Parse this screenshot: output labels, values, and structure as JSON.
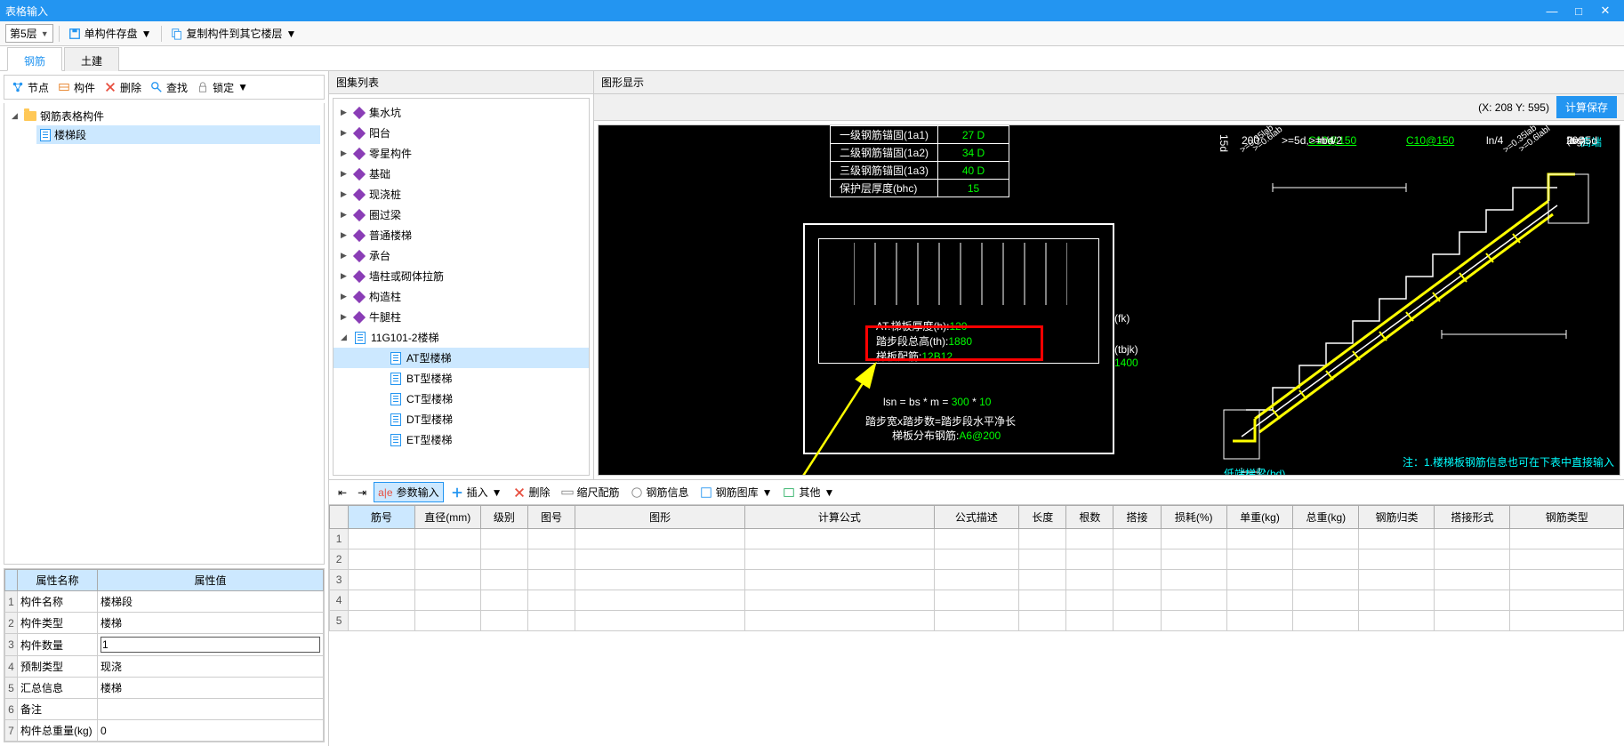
{
  "window": {
    "title": "表格输入"
  },
  "toolbar": {
    "floor_combo": "第5层",
    "save_single": "单构件存盘",
    "copy_to_floors": "复制构件到其它楼层"
  },
  "main_tabs": {
    "rebar": "钢筋",
    "civil": "土建"
  },
  "tree_toolbar": {
    "node": "节点",
    "component": "构件",
    "delete": "删除",
    "find": "查找",
    "lock": "锁定"
  },
  "tree": {
    "root": "钢筋表格构件",
    "child": "楼梯段"
  },
  "properties": {
    "header_name": "属性名称",
    "header_value": "属性值",
    "rows": [
      {
        "n": "1",
        "name": "构件名称",
        "value": "楼梯段"
      },
      {
        "n": "2",
        "name": "构件类型",
        "value": "楼梯"
      },
      {
        "n": "3",
        "name": "构件数量",
        "value": "1",
        "editing": true
      },
      {
        "n": "4",
        "name": "预制类型",
        "value": "现浇"
      },
      {
        "n": "5",
        "name": "汇总信息",
        "value": "楼梯"
      },
      {
        "n": "6",
        "name": "备注",
        "value": ""
      },
      {
        "n": "7",
        "name": "构件总重量(kg)",
        "value": "0"
      }
    ]
  },
  "catalog": {
    "header": "图集列表",
    "items": [
      {
        "label": "集水坑",
        "exp": "▶",
        "icon": "diamond"
      },
      {
        "label": "阳台",
        "exp": "▶",
        "icon": "diamond"
      },
      {
        "label": "零星构件",
        "exp": "▶",
        "icon": "diamond"
      },
      {
        "label": "基础",
        "exp": "▶",
        "icon": "diamond"
      },
      {
        "label": "现浇桩",
        "exp": "▶",
        "icon": "diamond"
      },
      {
        "label": "圈过梁",
        "exp": "▶",
        "icon": "diamond"
      },
      {
        "label": "普通楼梯",
        "exp": "▶",
        "icon": "diamond"
      },
      {
        "label": "承台",
        "exp": "▶",
        "icon": "diamond"
      },
      {
        "label": "墙柱或砌体拉筋",
        "exp": "▶",
        "icon": "diamond"
      },
      {
        "label": "构造柱",
        "exp": "▶",
        "icon": "diamond"
      },
      {
        "label": "牛腿柱",
        "exp": "▶",
        "icon": "diamond"
      },
      {
        "label": "11G101-2楼梯",
        "exp": "◢",
        "icon": "doc",
        "indent": 0
      },
      {
        "label": "AT型楼梯",
        "icon": "doc",
        "indent": 2,
        "selected": true
      },
      {
        "label": "BT型楼梯",
        "icon": "doc",
        "indent": 2
      },
      {
        "label": "CT型楼梯",
        "icon": "doc",
        "indent": 2
      },
      {
        "label": "DT型楼梯",
        "icon": "doc",
        "indent": 2
      },
      {
        "label": "ET型楼梯",
        "icon": "doc",
        "indent": 2
      }
    ]
  },
  "drawing": {
    "header": "图形显示",
    "coord": "(X: 208 Y: 595)",
    "save_btn": "计算保存",
    "table": [
      {
        "label": "一级钢筋锚固(1a1)",
        "value": "27 D"
      },
      {
        "label": "二级钢筋锚固(1a2)",
        "value": "34 D"
      },
      {
        "label": "三级钢筋锚固(1a3)",
        "value": "40 D"
      },
      {
        "label": "保护层厚度(bhc)",
        "value": "15"
      }
    ],
    "plan_labels": {
      "thickness": "AT.梯板厚度(h):",
      "thickness_v": "120",
      "step": "踏步段总高(th):",
      "step_v": "1880",
      "rebar": "梯板配筋:",
      "rebar_v": "12B12",
      "fk": "(fk)",
      "tbjk": "(tbjk)",
      "tbjk_v": "1400",
      "lsn": "lsn = bs * m = ",
      "lsn_v1": "300",
      "lsn_mul": " * ",
      "lsn_v2": "10",
      "text1": "踏步宽x踏步数=踏步段水平净长",
      "text2": "梯板分布钢筋:",
      "text2_v": "A6@200"
    },
    "stair": {
      "la": "la",
      "ln4a": "ln/4",
      "ln4b": "ln/4",
      "c10a": "C10@150",
      "c10b": "C10@150",
      "lab1": ">=0.35lab",
      "lab2": ">=0.6labl",
      "lab3": ">=0.35lab",
      "lab4": ">=0.6lab",
      "high": "高端",
      "bg200": "200",
      "bg": "(bg)",
      "d200": "200",
      "d5d": ">=5d,>=bd/2",
      "d15d": "15d",
      "d5d2": ">=5d",
      "low": "低端梯梁(bd)",
      "note": "注：1.楼梯板钢筋信息也可在下表中直接输入"
    }
  },
  "grid": {
    "toolbar": {
      "param": "参数输入",
      "insert": "插入",
      "delete": "删除",
      "scale": "缩尺配筋",
      "info": "钢筋信息",
      "lib": "钢筋图库",
      "other": "其他"
    },
    "cols": [
      "筋号",
      "直径(mm)",
      "级别",
      "图号",
      "图形",
      "计算公式",
      "公式描述",
      "长度",
      "根数",
      "搭接",
      "损耗(%)",
      "单重(kg)",
      "总重(kg)",
      "钢筋归类",
      "搭接形式",
      "钢筋类型"
    ],
    "rownums": [
      "1",
      "2",
      "3",
      "4",
      "5"
    ]
  }
}
